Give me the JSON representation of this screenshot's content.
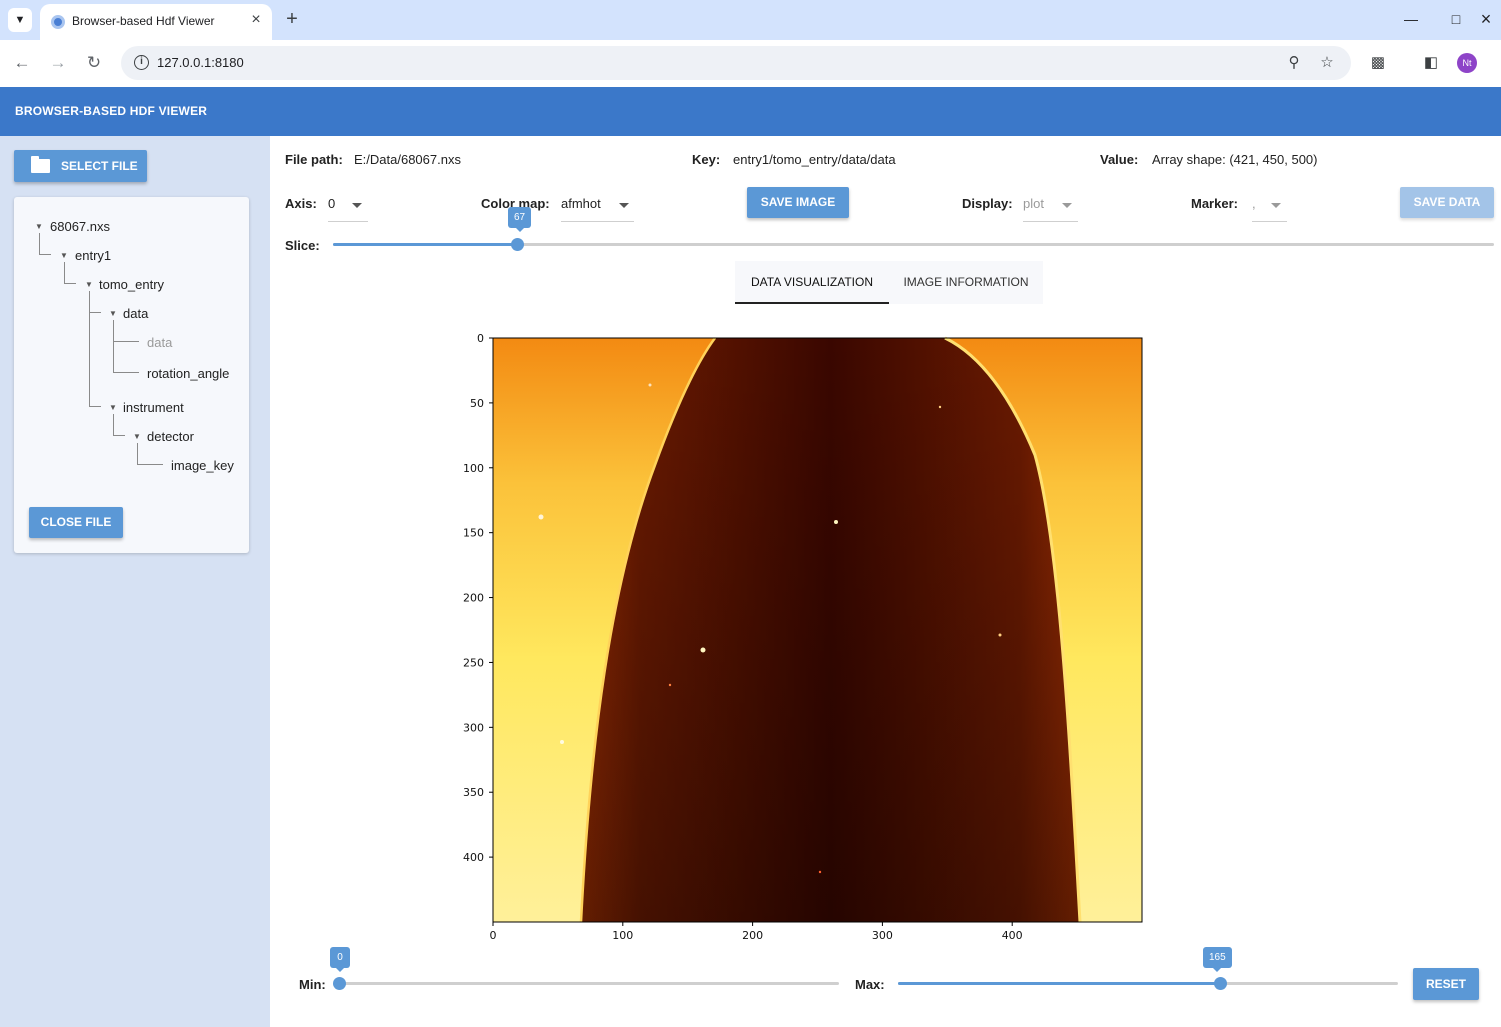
{
  "browser": {
    "tab_title": "Browser-based Hdf Viewer",
    "url": "127.0.0.1:8180",
    "profile_initials": "Nt"
  },
  "app": {
    "title": "BROWSER-BASED HDF VIEWER",
    "select_file": "SELECT FILE",
    "close_file": "CLOSE FILE"
  },
  "tree": {
    "items": [
      {
        "label": "68067.nxs",
        "state": "expanded"
      },
      {
        "label": "entry1",
        "state": "expanded"
      },
      {
        "label": "tomo_entry",
        "state": "expanded"
      },
      {
        "label": "data",
        "state": "expanded"
      },
      {
        "label": "data",
        "state": "selected"
      },
      {
        "label": "rotation_angle",
        "state": "leaf"
      },
      {
        "label": "instrument",
        "state": "expanded"
      },
      {
        "label": "detector",
        "state": "expanded"
      },
      {
        "label": "image_key",
        "state": "leaf"
      }
    ]
  },
  "info": {
    "file_path_label": "File path:",
    "file_path": "E:/Data/68067.nxs",
    "key_label": "Key:",
    "key": "entry1/tomo_entry/data/data",
    "value_label": "Value:",
    "value": "Array shape: (421, 450, 500)"
  },
  "controls": {
    "axis_label": "Axis:",
    "axis_value": "0",
    "colormap_label": "Color map:",
    "colormap_value": "afmhot",
    "save_image": "SAVE IMAGE",
    "display_label": "Display:",
    "display_value": "plot",
    "marker_label": "Marker:",
    "marker_value": ",",
    "save_data": "SAVE DATA",
    "slice_label": "Slice:",
    "slice_value": "67",
    "slice_max": 420
  },
  "view_tabs": {
    "data_visualization": "DATA VISUALIZATION",
    "image_information": "IMAGE INFORMATION"
  },
  "plot": {
    "x_ticks": [
      "0",
      "100",
      "200",
      "300",
      "400"
    ],
    "y_ticks": [
      "0",
      "50",
      "100",
      "150",
      "200",
      "250",
      "300",
      "350",
      "400"
    ],
    "xlim": [
      0,
      500
    ],
    "ylim": [
      450,
      0
    ],
    "colormap": "afmhot"
  },
  "range": {
    "min_label": "Min:",
    "min_value": "0",
    "max_label": "Max:",
    "max_value": "165",
    "reset": "RESET"
  },
  "colors": {
    "primary": "#3b78c9",
    "button": "#5b98d6",
    "sidebar": "#d6e1f3"
  }
}
